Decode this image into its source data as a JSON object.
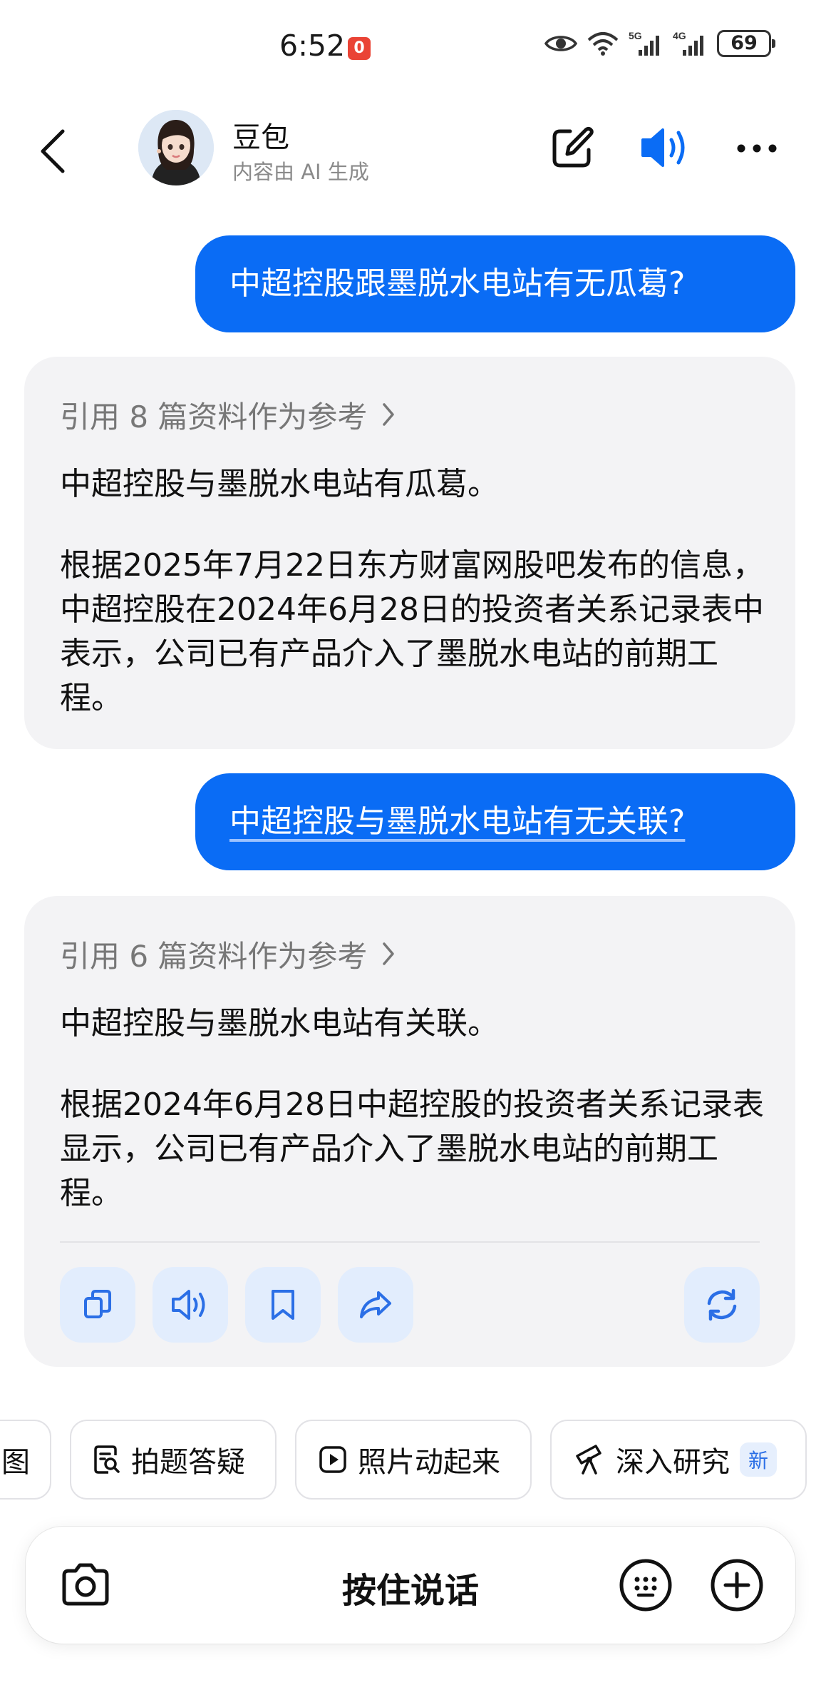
{
  "status_bar": {
    "time": "6:52",
    "rec_badge": "0",
    "battery": "69"
  },
  "header": {
    "bot_name": "豆包",
    "subtitle": "内容由 AI 生成"
  },
  "messages": [
    {
      "role": "user",
      "text": "中超控股跟墨脱水电站有无瓜葛?"
    },
    {
      "role": "bot",
      "reference": "引用 8 篇资料作为参考",
      "paragraphs": [
        "中超控股与墨脱水电站有瓜葛。",
        "根据2025年7月22日东方财富网股吧发布的信息，中超控股在2024年6月28日的投资者关系记录表中表示，公司已有产品介入了墨脱水电站的前期工程。"
      ]
    },
    {
      "role": "user",
      "text": "中超控股与墨脱水电站有无关联?"
    },
    {
      "role": "bot",
      "reference": "引用 6 篇资料作为参考",
      "paragraphs": [
        "中超控股与墨脱水电站有关联。",
        "根据2024年6月28日中超控股的投资者关系记录表显示，公司已有产品介入了墨脱水电站的前期工程。"
      ]
    }
  ],
  "actions": [
    "copy-icon",
    "speaker-icon",
    "bookmark-icon",
    "share-icon",
    "regenerate-icon"
  ],
  "chips": [
    {
      "label": "图",
      "icon": ""
    },
    {
      "label": "拍题答疑",
      "icon": "photo-search-icon"
    },
    {
      "label": "照片动起来",
      "icon": "play-icon"
    },
    {
      "label": "深入研究",
      "icon": "telescope-icon",
      "badge": "新"
    }
  ],
  "input": {
    "hold_to_talk": "按住说话"
  },
  "colors": {
    "accent": "#0a6cf5",
    "bot_bubble": "#f3f3f5",
    "action_bg": "#e2edfd"
  }
}
